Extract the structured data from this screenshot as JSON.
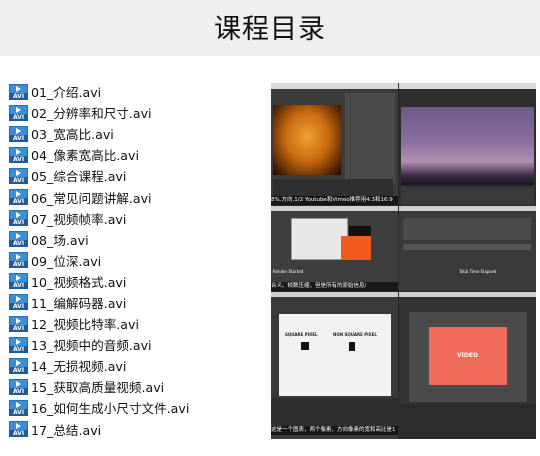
{
  "header": {
    "title": "课程目录"
  },
  "files": [
    "01_介绍.avi",
    "02_分辨率和尺寸.avi",
    "03_宽高比.avi",
    "04_像素宽高比.avi",
    "05_综合课程.avi",
    "06_常见问题讲解.avi",
    "07_视频帧率.avi",
    "08_场.avi",
    "09_位深.avi",
    "10_视频格式.avi",
    "11_编解码器.avi",
    "12_视频比特率.avi",
    "13_视频中的音频.avi",
    "14_无损视频.avi",
    "15_获取高质量视频.avi",
    "16_如何生成小尺寸文件.avi",
    "17_总结.avi"
  ],
  "file_icon_label": "AVI",
  "preview": {
    "caption_top": "8%.方向,1/2 Youtube和Vimeo推荐用4:3和16:9",
    "caption_mid": "合义。帧数压缩，但是所有的原始信息/",
    "caption_bottom": "这是一个图表，两个像素，方向像素的宽和高比是1",
    "square_pixel": "SQUARE PIXEL",
    "non_square_pixel": "NON SQUARE PIXEL",
    "video_label": "VIDEO",
    "render_label_a": "Render Started",
    "render_label_b": "Total Time Elapsed"
  }
}
